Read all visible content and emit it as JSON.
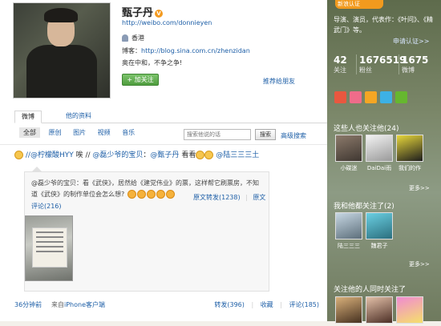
{
  "profile": {
    "name": "甄子丹",
    "url": "http://weibo.com/donnieyen",
    "location": "香港",
    "blog_label": "博客：",
    "blog_url": "http://blog.sina.com.cn/zhenzidan",
    "motto": "奥在中和，不争之争!",
    "follow_label": "+ 加关注",
    "recommend_label": "推荐给朋友"
  },
  "tabs": [
    "微博",
    "他的资料"
  ],
  "filters": [
    "全部",
    "原创",
    "图片",
    "视频",
    "音乐"
  ],
  "search": {
    "placeholder": "搜索他说的话",
    "button": "搜索",
    "advanced": "高级搜索"
  },
  "post": {
    "part1": "//@柠檬酸HYY",
    "part2": "唉 //",
    "mention1": "@磊少爷的宝贝",
    "part3": "：",
    "mention2": "@甄子丹",
    "part4": "看看",
    "mention3": "@陆三三三土",
    "quote": {
      "text": "@磊少爷的宝贝：看《武侠》，居然给《建党伟业》的票，这样帮它刷票房，不知道《武侠》的制作单位会怎么想?",
      "forward_label": "原文转发(1238)",
      "sep": "|",
      "original_label": "原文",
      "comment_label": "评论(216)"
    },
    "footer": {
      "time": "36分钟前",
      "source_prefix": "来自",
      "source": "iPhone客户端",
      "forward": "转发(396)",
      "sep": "|",
      "favorite": "收藏",
      "comment": "评论(185)"
    }
  },
  "sidebar": {
    "verify_badge": "新浪认证",
    "verify_text": "导演、演员，代表作：《叶问》、《精武门》等。",
    "apply": "申请认证>>",
    "stats": [
      {
        "num": "42",
        "label": "关注"
      },
      {
        "num": "1676519",
        "label": "粉丝"
      },
      {
        "num": "1675",
        "label": "微博"
      }
    ],
    "app_colors": [
      "#e9573f",
      "#ef6c8a",
      "#f5a623",
      "#3db1e5",
      "#66b72f"
    ],
    "followers_title": "这些人也关注他(24)",
    "followers": [
      "小碟迷",
      "DaiDai雨",
      "我们的作"
    ],
    "more": "更多>>",
    "mutual_title": "我和他都关注了(2)",
    "mutual": [
      "陆三三三",
      "魏君子"
    ],
    "more2": "更多>>",
    "third_title": "关注他的人同时关注了"
  }
}
